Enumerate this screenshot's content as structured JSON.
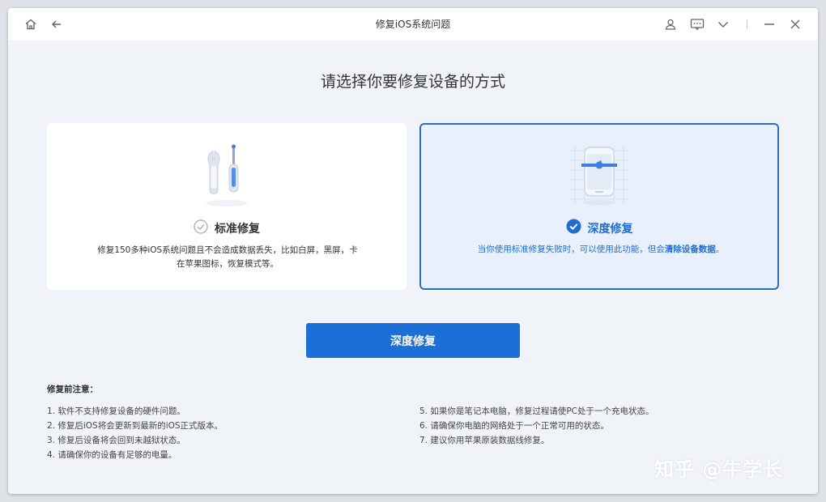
{
  "window": {
    "title": "修复iOS系统问题"
  },
  "titlebar": {
    "icons": [
      "home-icon",
      "back-arrow-icon",
      "user-icon",
      "feedback-icon",
      "chevron-down-icon",
      "minimize-icon",
      "close-icon"
    ]
  },
  "main": {
    "heading": "请选择你要修复设备的方式",
    "cards": [
      {
        "title": "标准修复",
        "desc_line1": "修复150多种iOS系统问题且不会造成数据丢失，比如白屏，黑屏，卡",
        "desc_line2": "在苹果图标，恢复模式等。",
        "selected": false
      },
      {
        "title": "深度修复",
        "desc_prefix": "当你使用标准修复失败时，可以使用此功能，但会",
        "desc_bold": "清除设备数据",
        "desc_suffix": "。",
        "selected": true
      }
    ],
    "primary_button": "深度修复"
  },
  "notes": {
    "title": "修复前注意：",
    "left": [
      "1.  软件不支持修复设备的硬件问题。",
      "2.  修复后iOS将会更新到最新的iOS正式版本。",
      "3.  修复后设备将会回到未越狱状态。",
      "4.  请确保你的设备有足够的电量。"
    ],
    "right": [
      "5.  如果你是笔记本电脑，修复过程请使PC处于一个充电状态。",
      "6.  请确保你电脑的网络处于一个正常可用的状态。",
      "7.  建议你用苹果原装数据线修复。"
    ]
  },
  "watermark": "知乎 @牛学长",
  "colors": {
    "accent": "#1d6fd8",
    "selected_border": "#2a6fba",
    "selected_bg": "#e8f1fb",
    "background": "#f0f4f8"
  }
}
